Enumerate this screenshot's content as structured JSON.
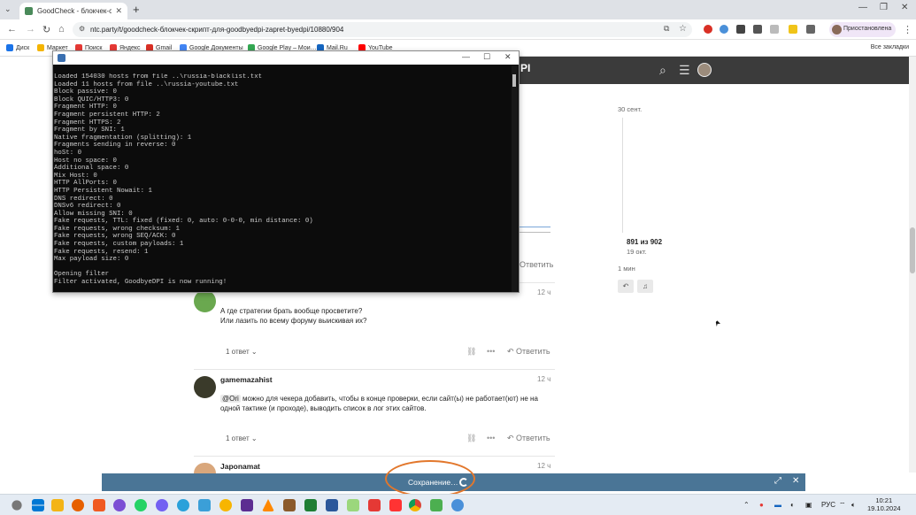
{
  "browser": {
    "tab_title": "GoodCheck - блокчек-скрипт-",
    "url": "ntc.party/t/goodcheck-блокчек-скрипт-для-goodbyedpi-zapret-byedpi/10880/904",
    "profile_label": "Приостановлена",
    "bookmarks": [
      "Диск",
      "Маркет",
      "Поиск",
      "Яндекс",
      "Gmail",
      "Google Документы",
      "Google Play – Мои…",
      "Mail.Ru",
      "YouTube"
    ],
    "all_bookmarks": "Все закладки"
  },
  "site": {
    "title_fragment": "PI"
  },
  "console": {
    "lines": [
      "Loaded 154030 hosts from file ..\\russia-blacklist.txt",
      "Loaded 11 hosts from file ..\\russia-youtube.txt",
      "Block passive: 0",
      "Block QUIC/HTTP3: 0",
      "Fragment HTTP: 0",
      "Fragment persistent HTTP: 2",
      "Fragment HTTPS: 2",
      "Fragment by SNI: 1",
      "Native fragmentation (splitting): 1",
      "Fragments sending in reverse: 0",
      "hoSt: 0",
      "Host no space: 0",
      "Additional space: 0",
      "Mix Host: 0",
      "HTTP AllPorts: 0",
      "HTTP Persistent Nowait: 1",
      "DNS redirect: 0",
      "DNSv6 redirect: 0",
      "Allow missing SNI: 0",
      "Fake requests, TTL: fixed (fixed: 0, auto: 0-0-0, min distance: 0)",
      "Fake requests, wrong checksum: 1",
      "Fake requests, wrong SEQ/ACK: 0",
      "Fake requests, custom payloads: 1",
      "Fake requests, resend: 1",
      "Max payload size: 0",
      "",
      "Opening filter",
      "Filter activated, GoodbyeDPI is now running!"
    ]
  },
  "timeline": {
    "start_date": "30 сент.",
    "position": "891 из 902",
    "position_date": "19 окт.",
    "ago": "1 мин"
  },
  "posts": [
    {
      "user": "",
      "time": "12 ч",
      "text": "А где стратегии брать вообще просветите?\nИли лазить по всему форуму выискивая их?",
      "answers": "1 ответ",
      "reply": "Ответить"
    },
    {
      "user": "gamemazahist",
      "time": "12 ч",
      "mention": "@Ori",
      "text": " можно для чекера добавить, чтобы в конце проверки, если сайт(ы) не работает(ют) не на одной тактике (и проходе), выводить список в лог этих сайтов.",
      "answers": "1 ответ",
      "reply": "Ответить"
    },
    {
      "user": "Japonamat",
      "time": "12 ч"
    }
  ],
  "reply_top": "Ответить",
  "save_bar": {
    "label": "Сохранение…"
  },
  "taskbar": {
    "lang": "РУС",
    "time": "10:21",
    "date": "19.10.2024"
  }
}
